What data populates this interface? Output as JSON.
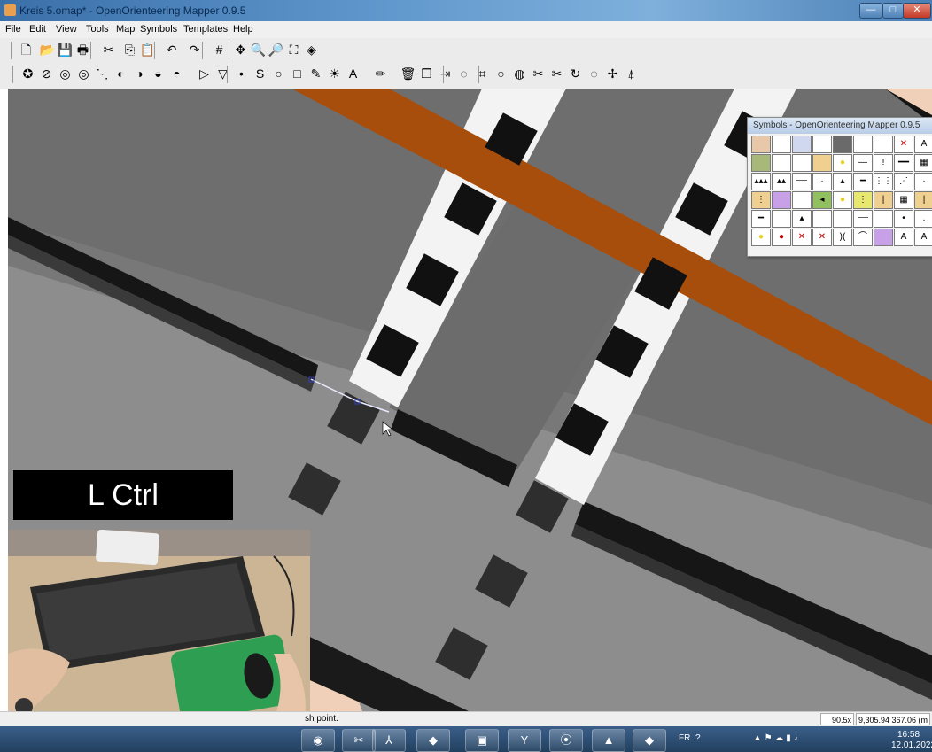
{
  "window": {
    "title": "Kreis 5.omap* - OpenOrienteering Mapper 0.9.5",
    "minimize_glyph": "—",
    "maximize_glyph": "□",
    "close_glyph": "✕"
  },
  "menu": {
    "items": [
      "File",
      "Edit",
      "View",
      "Tools",
      "Map",
      "Symbols",
      "Templates",
      "Help"
    ]
  },
  "toolbar1": {
    "icons": [
      "new-file-icon",
      "open-folder-icon",
      "save-icon",
      "print-icon",
      "cut-icon",
      "copy-icon",
      "paste-icon",
      "undo-icon",
      "redo-icon",
      "grid-icon",
      "pan-icon",
      "zoom-in-icon",
      "zoom-out-icon",
      "fullscreen-icon",
      "layers-icon"
    ],
    "glyphs": [
      "🗋",
      "📂",
      "💾",
      "🖶",
      "✂",
      "⎘",
      "📋",
      "↶",
      "↷",
      "#",
      "✥",
      "🔍",
      "🔎",
      "⛶",
      "◈"
    ]
  },
  "toolbar2": {
    "icons": [
      "show-all-symbols-icon",
      "hide-symbols-icon",
      "ring-icon",
      "ring2-icon",
      "dotted-line-icon",
      "circle-a-icon",
      "circle-b-icon",
      "circle-c-icon",
      "circle-d-icon",
      "edit-object-icon",
      "edit-line-icon",
      "point-icon",
      "path-icon",
      "circle-icon",
      "rectangle-icon",
      "freehand-icon",
      "fill-icon",
      "text-icon",
      "pencil-icon",
      "delete-icon",
      "duplicate-icon",
      "switch-dash-icon",
      "cut-area-icon",
      "connect-icon",
      "circle-tool-icon",
      "merge-icon",
      "scissors-icon",
      "cut-hole-icon",
      "rotate-icon",
      "rotate-pattern-icon",
      "move-icon",
      "measure-icon"
    ],
    "glyphs": [
      "✪",
      "⊘",
      "◎",
      "◎",
      "⋱",
      "◐",
      "◑",
      "◒",
      "◓",
      "▷",
      "▽",
      "•",
      "S",
      "○",
      "□",
      "✎",
      "☀",
      "A",
      "✏",
      "🗑",
      "❐",
      "⇥",
      "◌",
      "⌗",
      "○",
      "◍",
      "✂",
      "✂",
      "↻",
      "◌",
      "✢",
      "⍋"
    ]
  },
  "symbols_window": {
    "title": "Symbols - OpenOrienteering Mapper 0.9.5",
    "cells": [
      "",
      "",
      "",
      "",
      "",
      "",
      "",
      "✕",
      "A",
      "",
      "",
      "",
      "",
      "●",
      "—",
      "!",
      "━━",
      "▦",
      "▴▴▴",
      "▴▴",
      "┄┄",
      "·",
      "▴",
      "━",
      "⋮⋮",
      "⋰",
      "·",
      "⋮",
      "",
      "",
      "◂",
      "●",
      "⋮",
      "|",
      "▦",
      "|",
      "━",
      "",
      "▴",
      "",
      "",
      "┄┄",
      "",
      "•",
      ".",
      "●",
      "●",
      "✕",
      "✕",
      ")(",
      "⌒",
      "",
      "A",
      "A"
    ],
    "colors": [
      "#e8c8a8",
      "#ffffff",
      "#d0d8f0",
      "#ffffff",
      "#6a6a6a",
      "#ffffff",
      "#ffffff",
      "#ffffff",
      "#ffffff",
      "#a8b878",
      "#ffffff",
      "#ffffff",
      "#f0d090",
      "#ffffff",
      "#ffffff",
      "#ffffff",
      "#ffffff",
      "#ffffff",
      "#ffffff",
      "#ffffff",
      "#ffffff",
      "#ffffff",
      "#ffffff",
      "#ffffff",
      "#ffffff",
      "#ffffff",
      "#ffffff",
      "#f0d090",
      "#c8a0e8",
      "#ffffff",
      "#90c060",
      "#ffffff",
      "#e8e870",
      "#f0d090",
      "#ffffff",
      "#f0d090",
      "#ffffff",
      "#ffffff",
      "#ffffff",
      "#ffffff",
      "#ffffff",
      "#ffffff",
      "#ffffff",
      "#ffffff",
      "#ffffff",
      "#ffffff",
      "#ffffff",
      "#ffffff",
      "#ffffff",
      "#ffffff",
      "#ffffff",
      "#c8a0e8",
      "#ffffff",
      "#ffffff"
    ]
  },
  "overlay": {
    "key_label": "L Ctrl"
  },
  "status": {
    "message": "sh point.",
    "zoom": "90.5x",
    "coords": "9,305.94 367.06 (m"
  },
  "taskbar": {
    "apps": [
      "firefox-icon",
      "snipping-icon",
      "acrobat-icon",
      "openorienteering-icon",
      "powerpoint-icon",
      "inkscape-icon",
      "obs-icon",
      "vlc-icon",
      "openorienteering2-icon"
    ],
    "glyphs": [
      "◉",
      "✂",
      "⅄",
      "◆",
      "▣",
      "Y",
      "⦿",
      "▲",
      "◆"
    ],
    "language": "FR",
    "time": "16:58",
    "date": "12.01.2022"
  },
  "colors": {
    "road": "#a84e0c",
    "map_dark_gray": "#6c6c6c",
    "map_light_gray": "#8e8e8e",
    "black": "#141414",
    "white": "#f5f5f5"
  }
}
